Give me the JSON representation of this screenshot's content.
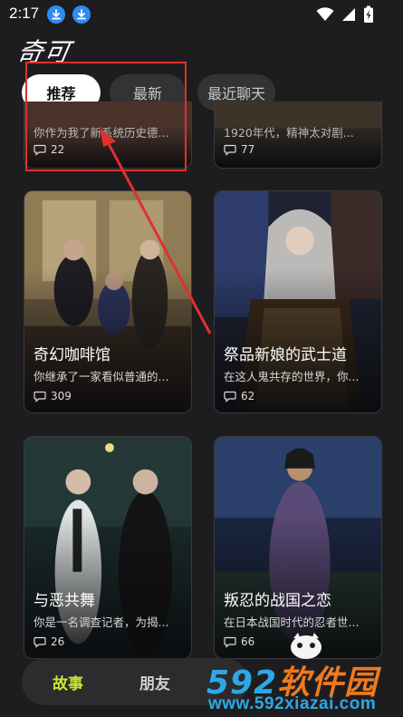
{
  "status_bar": {
    "time": "2:17"
  },
  "header": {
    "logo": "奇可"
  },
  "tabs": [
    {
      "label": "推荐",
      "active": true
    },
    {
      "label": "最新",
      "active": false
    },
    {
      "label": "最近聊天",
      "active": false
    }
  ],
  "partial_cards": [
    {
      "desc": "你作为我了新系统历史德...",
      "count": "22"
    },
    {
      "desc": "1920年代，精神太对剧...",
      "count": "77"
    }
  ],
  "cards": [
    {
      "title": "奇幻咖啡馆",
      "desc": "你继承了一家看似普通的...",
      "count": "309"
    },
    {
      "title": "祭品新娘的武士道",
      "desc": "在这人鬼共存的世界，你...",
      "count": "62"
    },
    {
      "title": "与恶共舞",
      "desc": "你是一名调查记者，为揭...",
      "count": "26"
    },
    {
      "title": "叛忍的战国之恋",
      "desc": "在日本战国时代的忍者世...",
      "count": "66"
    }
  ],
  "bottom_nav": {
    "story": "故事",
    "friends": "朋友"
  },
  "watermark": {
    "num": "592",
    "cn": "软件园",
    "url": "www.592xiazai.com"
  },
  "colors": {
    "accent": "#c8e82a",
    "annotation": "#e03030",
    "watermark_blue": "#2ea7e8",
    "watermark_orange": "#ee7a1f"
  }
}
